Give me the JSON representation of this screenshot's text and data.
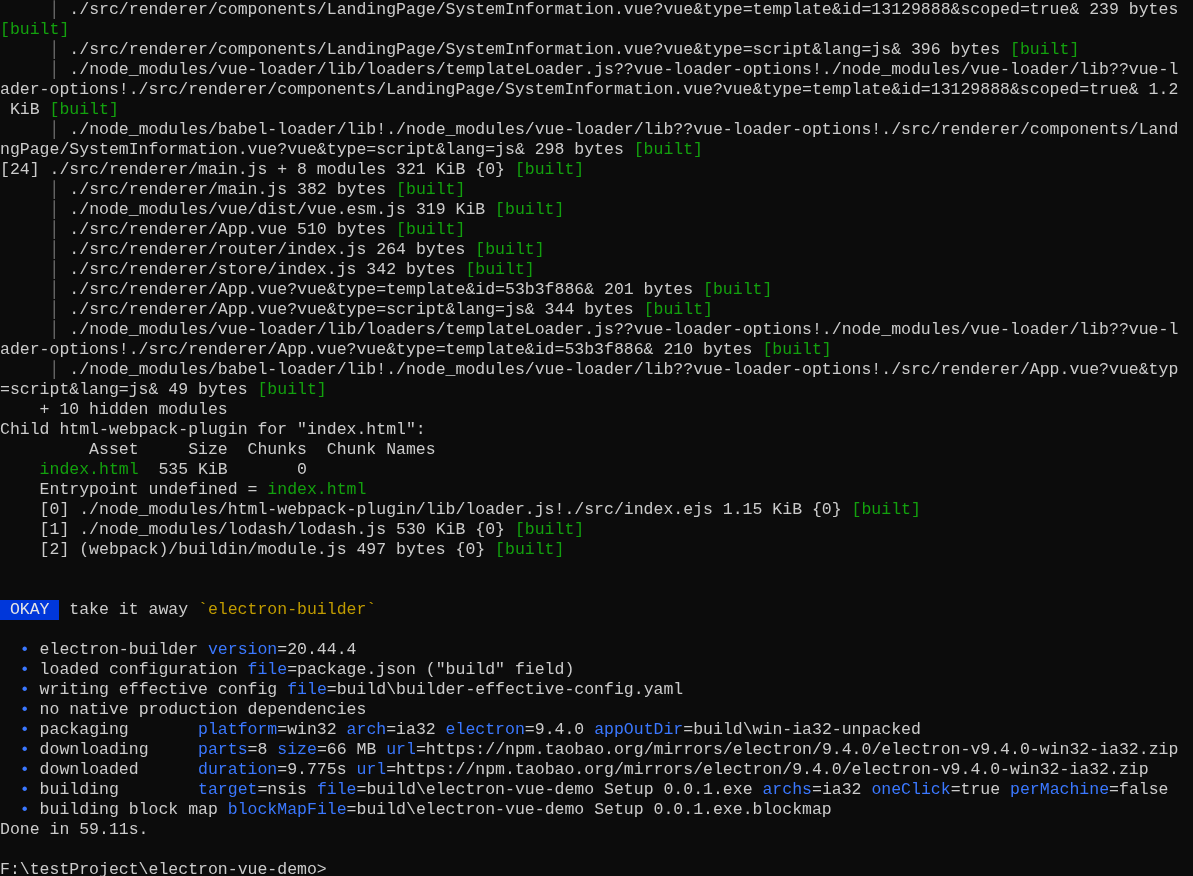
{
  "lines": [
    {
      "kind": "text",
      "segments": [
        {
          "kind": "guide",
          "text": "     │"
        },
        {
          "kind": "text",
          "text": " ./src/renderer/components/LandingPage/SystemInformation.vue?vue&type=template&id=13129888&scoped=true& 239 bytes"
        }
      ]
    },
    {
      "kind": "text",
      "segments": [
        {
          "kind": "built",
          "text": "[built]"
        }
      ]
    },
    {
      "kind": "text",
      "segments": [
        {
          "kind": "guide",
          "text": "     │"
        },
        {
          "kind": "text",
          "text": " ./src/renderer/components/LandingPage/SystemInformation.vue?vue&type=script&lang=js& 396 bytes "
        },
        {
          "kind": "built",
          "text": "[built]"
        }
      ]
    },
    {
      "kind": "text",
      "segments": [
        {
          "kind": "guide",
          "text": "     │"
        },
        {
          "kind": "text",
          "text": " ./node_modules/vue-loader/lib/loaders/templateLoader.js??vue-loader-options!./node_modules/vue-loader/lib??vue-l"
        }
      ]
    },
    {
      "kind": "text",
      "segments": [
        {
          "kind": "text",
          "text": "ader-options!./src/renderer/components/LandingPage/SystemInformation.vue?vue&type=template&id=13129888&scoped=true& 1.2"
        }
      ]
    },
    {
      "kind": "text",
      "segments": [
        {
          "kind": "text",
          "text": " KiB "
        },
        {
          "kind": "built",
          "text": "[built]"
        }
      ]
    },
    {
      "kind": "text",
      "segments": [
        {
          "kind": "guide",
          "text": "     │"
        },
        {
          "kind": "text",
          "text": " ./node_modules/babel-loader/lib!./node_modules/vue-loader/lib??vue-loader-options!./src/renderer/components/Land"
        }
      ]
    },
    {
      "kind": "text",
      "segments": [
        {
          "kind": "text",
          "text": "ngPage/SystemInformation.vue?vue&type=script&lang=js& 298 bytes "
        },
        {
          "kind": "built",
          "text": "[built]"
        }
      ]
    },
    {
      "kind": "text",
      "segments": [
        {
          "kind": "text",
          "text": "[24] ./src/renderer/main.js + 8 modules 321 KiB {0} "
        },
        {
          "kind": "built",
          "text": "[built]"
        }
      ]
    },
    {
      "kind": "text",
      "segments": [
        {
          "kind": "guide",
          "text": "     │"
        },
        {
          "kind": "text",
          "text": " ./src/renderer/main.js 382 bytes "
        },
        {
          "kind": "built",
          "text": "[built]"
        }
      ]
    },
    {
      "kind": "text",
      "segments": [
        {
          "kind": "guide",
          "text": "     │"
        },
        {
          "kind": "text",
          "text": " ./node_modules/vue/dist/vue.esm.js 319 KiB "
        },
        {
          "kind": "built",
          "text": "[built]"
        }
      ]
    },
    {
      "kind": "text",
      "segments": [
        {
          "kind": "guide",
          "text": "     │"
        },
        {
          "kind": "text",
          "text": " ./src/renderer/App.vue 510 bytes "
        },
        {
          "kind": "built",
          "text": "[built]"
        }
      ]
    },
    {
      "kind": "text",
      "segments": [
        {
          "kind": "guide",
          "text": "     │"
        },
        {
          "kind": "text",
          "text": " ./src/renderer/router/index.js 264 bytes "
        },
        {
          "kind": "built",
          "text": "[built]"
        }
      ]
    },
    {
      "kind": "text",
      "segments": [
        {
          "kind": "guide",
          "text": "     │"
        },
        {
          "kind": "text",
          "text": " ./src/renderer/store/index.js 342 bytes "
        },
        {
          "kind": "built",
          "text": "[built]"
        }
      ]
    },
    {
      "kind": "text",
      "segments": [
        {
          "kind": "guide",
          "text": "     │"
        },
        {
          "kind": "text",
          "text": " ./src/renderer/App.vue?vue&type=template&id=53b3f886& 201 bytes "
        },
        {
          "kind": "built",
          "text": "[built]"
        }
      ]
    },
    {
      "kind": "text",
      "segments": [
        {
          "kind": "guide",
          "text": "     │"
        },
        {
          "kind": "text",
          "text": " ./src/renderer/App.vue?vue&type=script&lang=js& 344 bytes "
        },
        {
          "kind": "built",
          "text": "[built]"
        }
      ]
    },
    {
      "kind": "text",
      "segments": [
        {
          "kind": "guide",
          "text": "     │"
        },
        {
          "kind": "text",
          "text": " ./node_modules/vue-loader/lib/loaders/templateLoader.js??vue-loader-options!./node_modules/vue-loader/lib??vue-l"
        }
      ]
    },
    {
      "kind": "text",
      "segments": [
        {
          "kind": "text",
          "text": "ader-options!./src/renderer/App.vue?vue&type=template&id=53b3f886& 210 bytes "
        },
        {
          "kind": "built",
          "text": "[built]"
        }
      ]
    },
    {
      "kind": "text",
      "segments": [
        {
          "kind": "guide",
          "text": "     │"
        },
        {
          "kind": "text",
          "text": " ./node_modules/babel-loader/lib!./node_modules/vue-loader/lib??vue-loader-options!./src/renderer/App.vue?vue&typ"
        }
      ]
    },
    {
      "kind": "text",
      "segments": [
        {
          "kind": "text",
          "text": "=script&lang=js& 49 bytes "
        },
        {
          "kind": "built",
          "text": "[built]"
        }
      ]
    },
    {
      "kind": "text",
      "segments": [
        {
          "kind": "text",
          "text": "    + 10 hidden modules"
        }
      ]
    },
    {
      "kind": "text",
      "segments": [
        {
          "kind": "text",
          "text": "Child html-webpack-plugin for \"index.html\":"
        }
      ]
    },
    {
      "kind": "text",
      "segments": [
        {
          "kind": "text",
          "text": "         Asset     Size  Chunks  Chunk Names"
        }
      ]
    },
    {
      "kind": "text",
      "segments": [
        {
          "kind": "built",
          "text": "    index.html"
        },
        {
          "kind": "text",
          "text": "  535 KiB       0"
        }
      ]
    },
    {
      "kind": "text",
      "segments": [
        {
          "kind": "text",
          "text": "    Entrypoint undefined = "
        },
        {
          "kind": "built",
          "text": "index.html"
        }
      ]
    },
    {
      "kind": "text",
      "segments": [
        {
          "kind": "text",
          "text": "    [0] ./node_modules/html-webpack-plugin/lib/loader.js!./src/index.ejs 1.15 KiB {0} "
        },
        {
          "kind": "built",
          "text": "[built]"
        }
      ]
    },
    {
      "kind": "text",
      "segments": [
        {
          "kind": "text",
          "text": "    [1] ./node_modules/lodash/lodash.js 530 KiB {0} "
        },
        {
          "kind": "built",
          "text": "[built]"
        }
      ]
    },
    {
      "kind": "text",
      "segments": [
        {
          "kind": "text",
          "text": "    [2] (webpack)/buildin/module.js 497 bytes {0} "
        },
        {
          "kind": "built",
          "text": "[built]"
        }
      ]
    },
    {
      "kind": "blank"
    },
    {
      "kind": "blank"
    },
    {
      "kind": "text",
      "segments": [
        {
          "kind": "badge",
          "text": "OKAY"
        },
        {
          "kind": "text",
          "text": " take it away "
        },
        {
          "kind": "quote",
          "text": "`electron-builder`"
        }
      ]
    },
    {
      "kind": "blank"
    },
    {
      "kind": "text",
      "segments": [
        {
          "kind": "key",
          "text": "  •"
        },
        {
          "kind": "text",
          "text": " electron-builder "
        },
        {
          "kind": "key",
          "text": "version"
        },
        {
          "kind": "text",
          "text": "=20.44.4"
        }
      ]
    },
    {
      "kind": "text",
      "segments": [
        {
          "kind": "key",
          "text": "  •"
        },
        {
          "kind": "text",
          "text": " loaded configuration "
        },
        {
          "kind": "key",
          "text": "file"
        },
        {
          "kind": "text",
          "text": "=package.json (\"build\" field)"
        }
      ]
    },
    {
      "kind": "text",
      "segments": [
        {
          "kind": "key",
          "text": "  •"
        },
        {
          "kind": "text",
          "text": " writing effective config "
        },
        {
          "kind": "key",
          "text": "file"
        },
        {
          "kind": "text",
          "text": "=build\\builder-effective-config.yaml"
        }
      ]
    },
    {
      "kind": "text",
      "segments": [
        {
          "kind": "key",
          "text": "  •"
        },
        {
          "kind": "text",
          "text": " no native production dependencies"
        }
      ]
    },
    {
      "kind": "text",
      "segments": [
        {
          "kind": "key",
          "text": "  •"
        },
        {
          "kind": "text",
          "text": " packaging       "
        },
        {
          "kind": "key",
          "text": "platform"
        },
        {
          "kind": "text",
          "text": "=win32 "
        },
        {
          "kind": "key",
          "text": "arch"
        },
        {
          "kind": "text",
          "text": "=ia32 "
        },
        {
          "kind": "key",
          "text": "electron"
        },
        {
          "kind": "text",
          "text": "=9.4.0 "
        },
        {
          "kind": "key",
          "text": "appOutDir"
        },
        {
          "kind": "text",
          "text": "=build\\win-ia32-unpacked"
        }
      ]
    },
    {
      "kind": "text",
      "segments": [
        {
          "kind": "key",
          "text": "  •"
        },
        {
          "kind": "text",
          "text": " downloading     "
        },
        {
          "kind": "key",
          "text": "parts"
        },
        {
          "kind": "text",
          "text": "=8 "
        },
        {
          "kind": "key",
          "text": "size"
        },
        {
          "kind": "text",
          "text": "=66 MB "
        },
        {
          "kind": "key",
          "text": "url"
        },
        {
          "kind": "text",
          "text": "=https://npm.taobao.org/mirrors/electron/9.4.0/electron-v9.4.0-win32-ia32.zip"
        }
      ]
    },
    {
      "kind": "text",
      "segments": [
        {
          "kind": "key",
          "text": "  •"
        },
        {
          "kind": "text",
          "text": " downloaded      "
        },
        {
          "kind": "key",
          "text": "duration"
        },
        {
          "kind": "text",
          "text": "=9.775s "
        },
        {
          "kind": "key",
          "text": "url"
        },
        {
          "kind": "text",
          "text": "=https://npm.taobao.org/mirrors/electron/9.4.0/electron-v9.4.0-win32-ia32.zip"
        }
      ]
    },
    {
      "kind": "text",
      "segments": [
        {
          "kind": "key",
          "text": "  •"
        },
        {
          "kind": "text",
          "text": " building        "
        },
        {
          "kind": "key",
          "text": "target"
        },
        {
          "kind": "text",
          "text": "=nsis "
        },
        {
          "kind": "key",
          "text": "file"
        },
        {
          "kind": "text",
          "text": "=build\\electron-vue-demo Setup 0.0.1.exe "
        },
        {
          "kind": "key",
          "text": "archs"
        },
        {
          "kind": "text",
          "text": "=ia32 "
        },
        {
          "kind": "key",
          "text": "oneClick"
        },
        {
          "kind": "text",
          "text": "=true "
        },
        {
          "kind": "key",
          "text": "perMachine"
        },
        {
          "kind": "text",
          "text": "=false"
        }
      ]
    },
    {
      "kind": "text",
      "segments": [
        {
          "kind": "key",
          "text": "  •"
        },
        {
          "kind": "text",
          "text": " building block map "
        },
        {
          "kind": "key",
          "text": "blockMapFile"
        },
        {
          "kind": "text",
          "text": "=build\\electron-vue-demo Setup 0.0.1.exe.blockmap"
        }
      ]
    },
    {
      "kind": "text",
      "segments": [
        {
          "kind": "text",
          "text": "Done in 59.11s."
        }
      ]
    },
    {
      "kind": "blank"
    },
    {
      "kind": "text",
      "segments": [
        {
          "kind": "text",
          "text": "F:\\testProject\\electron-vue-demo>"
        }
      ]
    }
  ]
}
